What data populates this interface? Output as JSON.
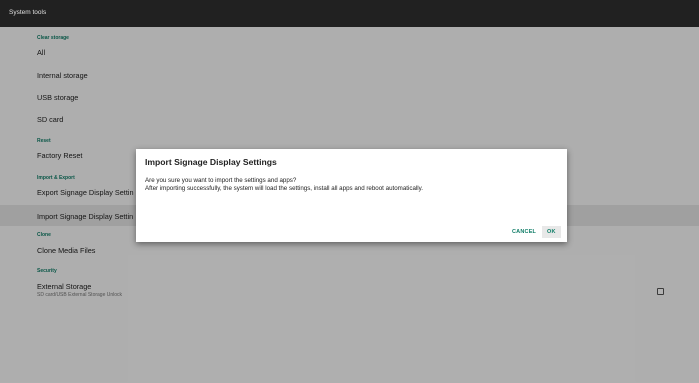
{
  "titlebar": {
    "title": "System tools"
  },
  "sections": {
    "clear_storage": {
      "header": "Clear storage",
      "items": [
        "All",
        "Internal storage",
        "USB storage",
        "SD card"
      ]
    },
    "reset": {
      "header": "Reset",
      "items": [
        "Factory Reset"
      ]
    },
    "import_export": {
      "header": "Import & Export",
      "items": [
        "Export Signage Display Settings",
        "Import Signage Display Settings"
      ],
      "visible_items": [
        "Export Signage Display Settin",
        "Import Signage Display Settin"
      ]
    },
    "clone": {
      "header": "Clone",
      "items": [
        "Clone Media Files"
      ]
    },
    "security": {
      "header": "Security",
      "item": {
        "label": "External Storage",
        "sublabel": "SD card/USB External Storage Unlock",
        "checked": false
      }
    }
  },
  "dialog": {
    "title": "Import Signage Display Settings",
    "line1": "Are you sure you want to import the settings and apps?",
    "line2": "After importing successfully, the system will load the settings, install all apps and reboot automatically.",
    "cancel_label": "CANCEL",
    "ok_label": "OK"
  },
  "colors": {
    "titlebar": "#212121",
    "accent": "#0e7c66",
    "background": "#fafafa",
    "selected_row": "#e6e6e6"
  }
}
